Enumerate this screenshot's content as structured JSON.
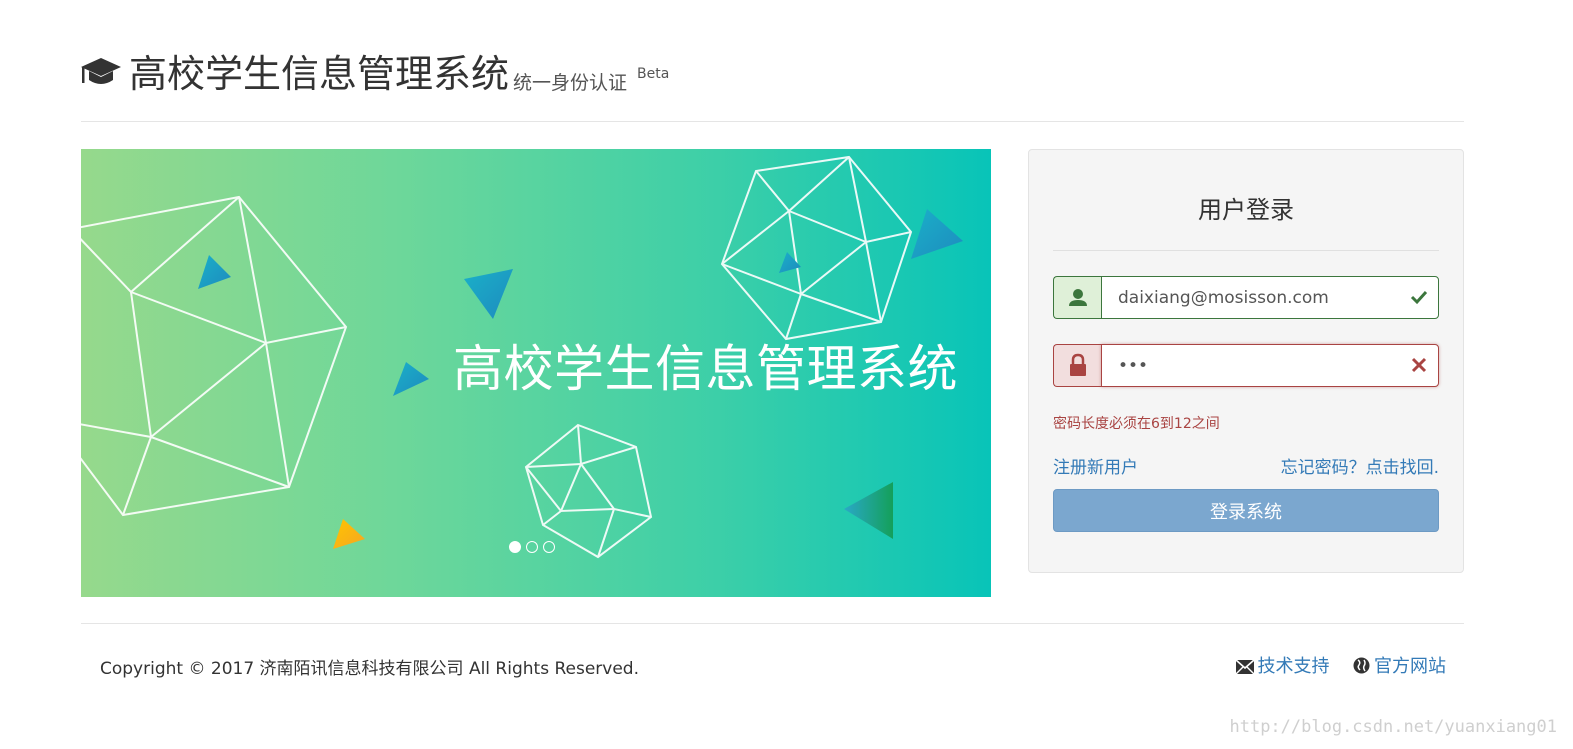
{
  "header": {
    "icon": "graduation-cap-icon",
    "title": "高校学生信息管理系统",
    "subtitle": "统一身份认证",
    "badge": "Beta"
  },
  "banner": {
    "title": "高校学生信息管理系统",
    "slides": 3,
    "active_slide": 1,
    "colors": {
      "left": "#96d98c",
      "right": "#08c4b8"
    }
  },
  "login": {
    "title": "用户登录",
    "username": {
      "icon": "user-icon",
      "value": "daixiang@mosisson.com",
      "status_icon": "check-icon"
    },
    "password": {
      "icon": "lock-icon",
      "value": "•••",
      "status_icon": "times-icon"
    },
    "error": "密码长度必须在6到12之间",
    "register_link": "注册新用户",
    "forgot_link": "忘记密码？点击找回.",
    "submit": "登录系统"
  },
  "footer": {
    "copyright": "Copyright © 2017 济南陌讯信息科技有限公司 All Rights Reserved.",
    "support": {
      "icon": "envelope-icon",
      "label": "技术支持"
    },
    "website": {
      "icon": "globe-icon",
      "label": "官方网站"
    }
  },
  "watermark": "http://blog.csdn.net/yuanxiang01",
  "colors": {
    "success": "#3c763d",
    "danger": "#a94442",
    "link": "#337ab7",
    "button": "#7ba7cf"
  }
}
